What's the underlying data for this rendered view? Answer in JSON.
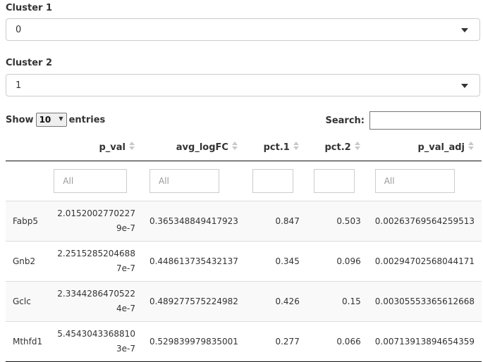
{
  "cluster1": {
    "label": "Cluster 1",
    "value": "0"
  },
  "cluster2": {
    "label": "Cluster 2",
    "value": "1"
  },
  "length": {
    "prefix": "Show",
    "value": "10",
    "suffix": "entries"
  },
  "search": {
    "label": "Search:",
    "value": ""
  },
  "columns": [
    "",
    "p_val",
    "avg_logFC",
    "pct.1",
    "pct.2",
    "p_val_adj"
  ],
  "filters": {
    "p_val": "All",
    "avg_logFC": "All",
    "pct1": "",
    "pct2": "",
    "p_val_adj": "All"
  },
  "rows": [
    {
      "gene": "Fabp5",
      "p_val": "2.01520027702279e-7",
      "avg_logFC": "0.365348849417923",
      "pct1": "0.847",
      "pct2": "0.503",
      "p_val_adj": "0.00263769564259513"
    },
    {
      "gene": "Gnb2",
      "p_val": "2.25152852046887e-7",
      "avg_logFC": "0.448613735432137",
      "pct1": "0.345",
      "pct2": "0.096",
      "p_val_adj": "0.00294702568044171"
    },
    {
      "gene": "Gclc",
      "p_val": "2.33442864705224e-7",
      "avg_logFC": "0.489277575224982",
      "pct1": "0.426",
      "pct2": "0.15",
      "p_val_adj": "0.00305553365612668"
    },
    {
      "gene": "Mthfd1",
      "p_val": "5.45430433688103e-7",
      "avg_logFC": "0.529839979835001",
      "pct1": "0.277",
      "pct2": "0.066",
      "p_val_adj": "0.00713913894654359"
    }
  ]
}
